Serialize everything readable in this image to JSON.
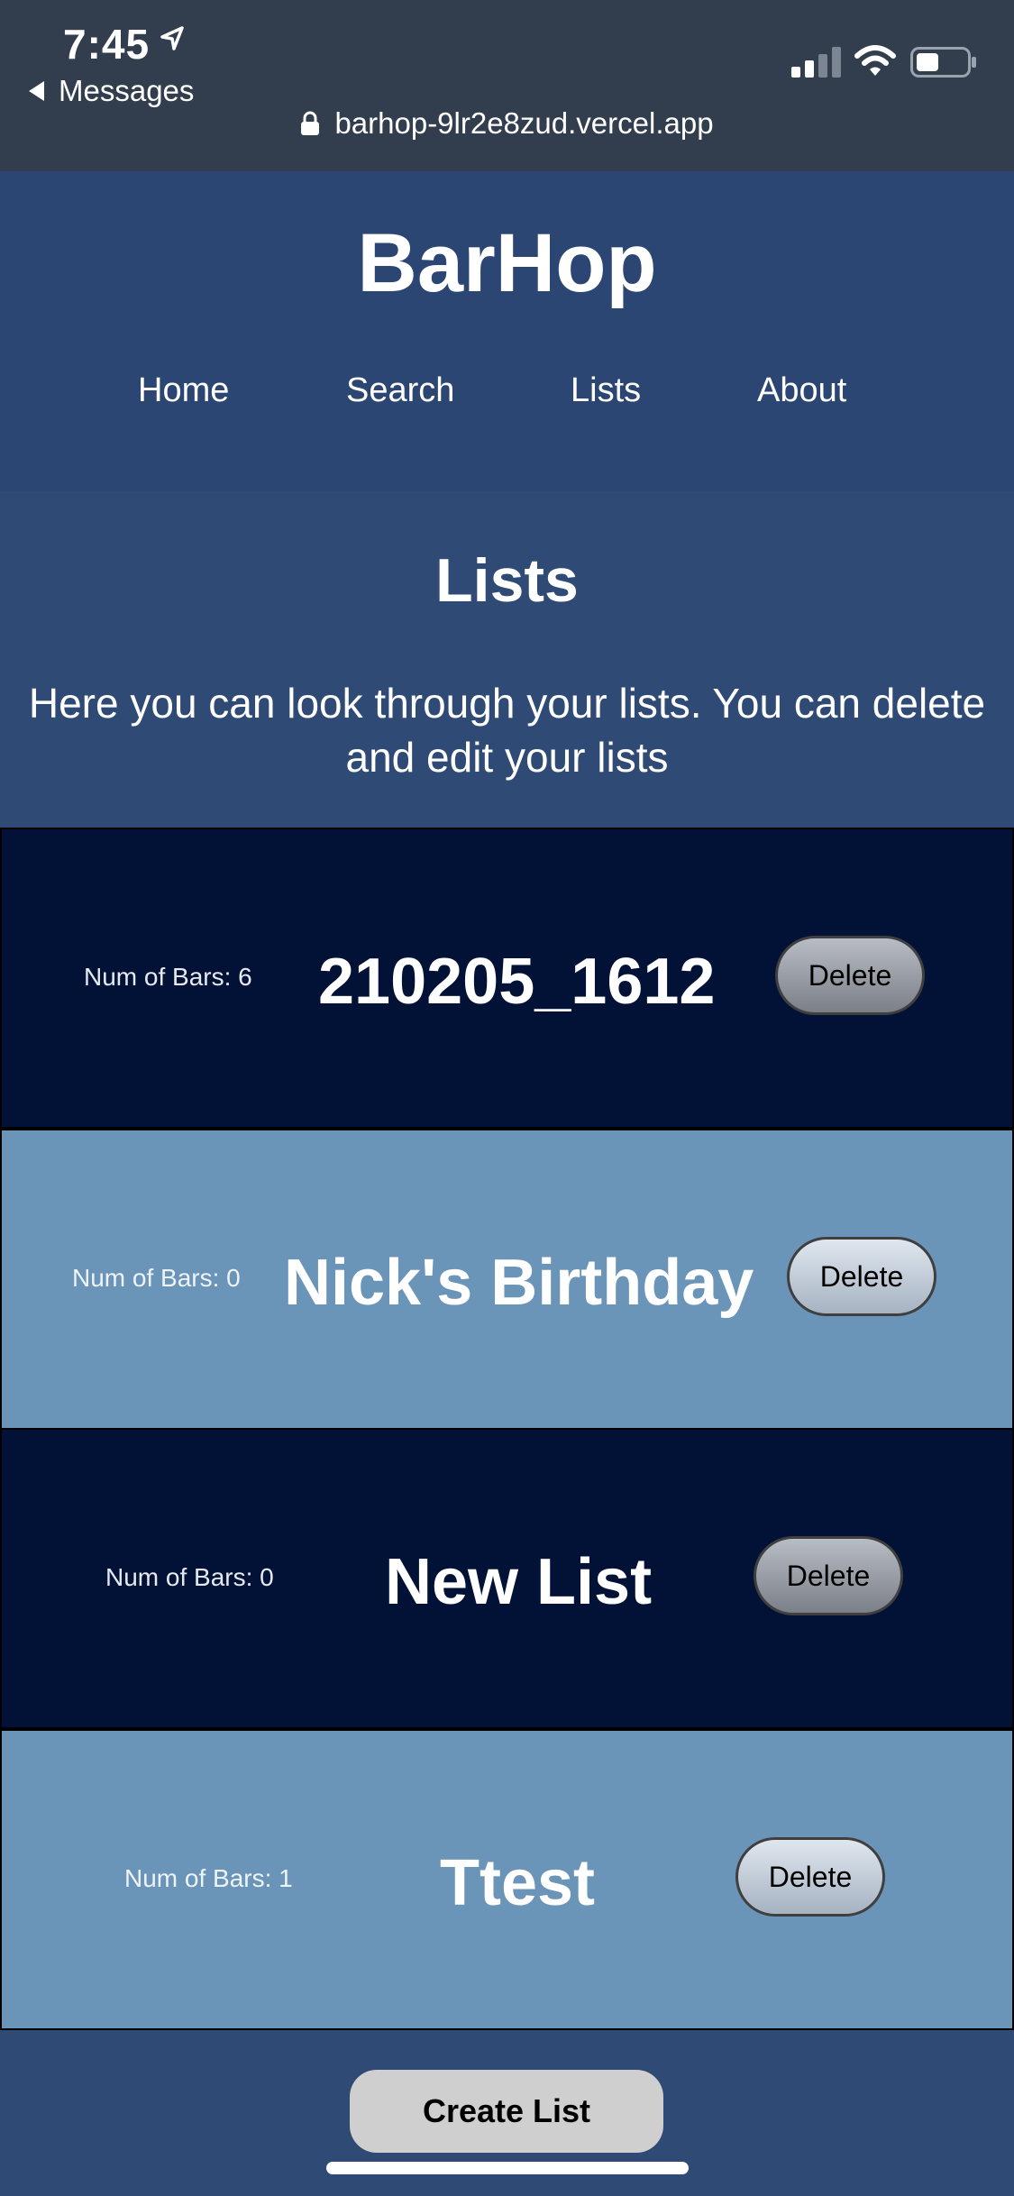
{
  "status_bar": {
    "time": "7:45",
    "back_label": "Messages",
    "url": "barhop-9lr2e8zud.vercel.app"
  },
  "header": {
    "brand": "BarHop",
    "nav": [
      "Home",
      "Search",
      "Lists",
      "About"
    ]
  },
  "intro": {
    "title": "Lists",
    "description": "Here you can look through your lists. You can delete and edit your lists"
  },
  "lists": [
    {
      "count_label": "Num of Bars: 6",
      "name": "210205_1612",
      "delete_label": "Delete",
      "theme": "dark"
    },
    {
      "count_label": "Num of Bars: 0",
      "name": "Nick's Birthday",
      "delete_label": "Delete",
      "theme": "light"
    },
    {
      "count_label": "Num of Bars: 0",
      "name": "New List",
      "delete_label": "Delete",
      "theme": "dark"
    },
    {
      "count_label": "Num of Bars: 1",
      "name": "Ttest",
      "delete_label": "Delete",
      "theme": "light"
    }
  ],
  "create_button": "Create List",
  "colors": {
    "header_bg": "#2b4672",
    "page_bg": "#2f4a74",
    "row_dark": "#021236",
    "row_light": "#6b94b9"
  }
}
